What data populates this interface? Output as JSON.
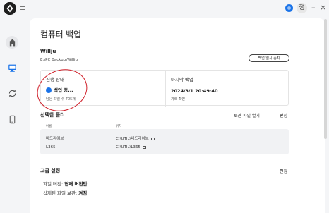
{
  "titlebar": {
    "user_initial": "정",
    "minimize": "–",
    "close": "×"
  },
  "icons": {
    "app_logo": "app-logo-icon",
    "menu": "hamburger-menu-icon",
    "home": "home-icon",
    "backup": "monitor-icon",
    "sync": "sync-icon",
    "phone": "phone-icon"
  },
  "colors": {
    "accent": "#1a73e8",
    "annotation": "#d0202a"
  },
  "main": {
    "title": "컴퓨터 백업",
    "device_name": "Willju",
    "device_path": "E:\\PC Backup\\Willju",
    "pause_button": "백업 일시 중지"
  },
  "status": {
    "progress_label": "진행 상태",
    "progress_status": "백업 중...",
    "remaining": "남은 파일 수 705개",
    "last_label": "마지막 백업",
    "last_date": "2024/3/1 20:49:40",
    "history_link": "기록 확인"
  },
  "folders": {
    "title": "선택한 폴더",
    "view_link": "보관 파일 열기",
    "edit_link": "편집",
    "col_name": "이름",
    "col_location": "위치",
    "rows": [
      {
        "name": "바드라이브",
        "location": "C:\\UTIL\\바드라이브"
      },
      {
        "name": "L365",
        "location": "C:\\UTIL\\L365"
      }
    ]
  },
  "advanced": {
    "title": "고급 설정",
    "edit_link": "편집",
    "version_label": "파일 버전:",
    "version_value": "현재 버전만",
    "deleted_label": "삭제된 파일 보관:",
    "deleted_value": "켜짐"
  }
}
